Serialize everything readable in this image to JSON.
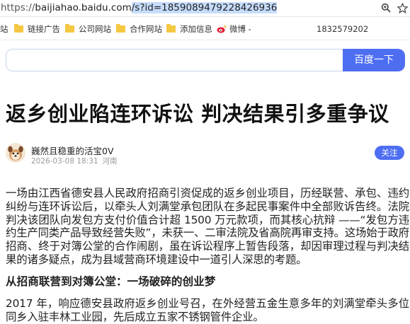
{
  "address_bar": {
    "url_prefix": "https://",
    "url_host": "baijiahao.baidu.com",
    "url_path": "/s?id=1859089479228426936",
    "icons": [
      "search-icon",
      "star-icon"
    ]
  },
  "bookmarks": [
    {
      "label": "站",
      "icon": "folder-icon"
    },
    {
      "label": "链接广告",
      "icon": "folder-icon"
    },
    {
      "label": "公司网站",
      "icon": "folder-icon"
    },
    {
      "label": "合作网站",
      "icon": "folder-icon"
    },
    {
      "label": "添加信息",
      "icon": "folder-icon"
    },
    {
      "label": "微博 -",
      "icon": "weibo-icon"
    },
    {
      "label": "1832579202",
      "icon": ""
    }
  ],
  "search": {
    "query": "",
    "button_label": "百度一下"
  },
  "article": {
    "title": "返乡创业陷连环诉讼 判决结果引多重争议",
    "author": "巍然且稳重的活宝0V",
    "date": "2026-03-08 18:31",
    "location": "河南",
    "follow_label": "关注",
    "paragraph1": "一场由江西省德安县人民政府招商引资促成的返乡创业项目，历经联营、承包、违约纠纷与连环诉讼后，以牵头人刘满堂承包团队在多起民事案件中全部败诉告终。法院判决该团队向发包方支付价值合计超 1500 万元款项，而其核心抗辩 ——“发包方违约生产同类产品导致经营失败”，未获一、二审法院及省高院再审支持。这场始于政府招商、终于对簿公堂的合作闹剧，虽在诉讼程序上暂告段落，却因审理过程与判决结果的诸多疑点，成为县域营商环境建设中一道引人深思的考题。",
    "subheading": "从招商联营到对簿公堂：一场破碎的创业梦",
    "paragraph2": "2017 年，响应德安县政府返乡创业号召，在外经营五金生意多年的刘满堂牵头多位同乡入驻丰林工业园，先后成立五家不锈钢管件企业。"
  },
  "colors": {
    "accent": "#4e6ef2",
    "folder": "#f5c842",
    "selection": "#c6dcfb"
  }
}
